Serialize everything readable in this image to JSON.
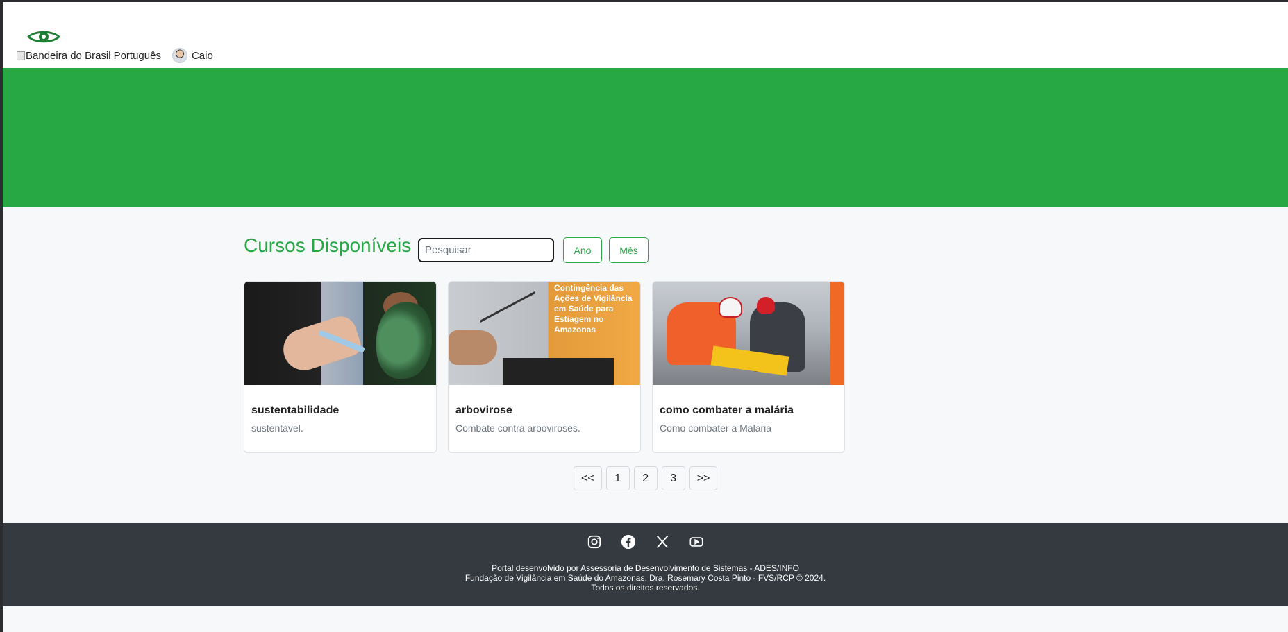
{
  "header": {
    "flag_alt": "Bandeira do Brasil",
    "language": "Português",
    "user_name": "Caio"
  },
  "main": {
    "title": "Cursos Disponíveis",
    "search_placeholder": "Pesquisar",
    "filter_year": "Ano",
    "filter_month": "Mês",
    "courses": [
      {
        "title": "sustentabilidade",
        "description": "sustentável."
      },
      {
        "title": "arbovirose",
        "description": "Combate contra arboviroses."
      },
      {
        "title": "como combater a malária",
        "description": "Como combater a Malária"
      }
    ],
    "poster_text": "Contingência das Ações de Vigilância em Saúde para Estiagem no Amazonas",
    "pagination": {
      "first": "<<",
      "pages": [
        "1",
        "2",
        "3"
      ],
      "last": ">>"
    }
  },
  "footer": {
    "social_icons": [
      "instagram-icon",
      "facebook-icon",
      "x-icon",
      "youtube-icon"
    ],
    "line1": "Portal desenvolvido por Assessoria de Desenvolvimento de Sistemas - ADES/INFO",
    "line2": "Fundação de Vigilância em Saúde do Amazonas, Dra. Rosemary Costa Pinto - FVS/RCP © 2024.",
    "line3": "Todos os direitos reservados."
  },
  "colors": {
    "brand_green": "#28a745",
    "footer_bg": "#343a40",
    "logo_green": "#1e7e34"
  }
}
